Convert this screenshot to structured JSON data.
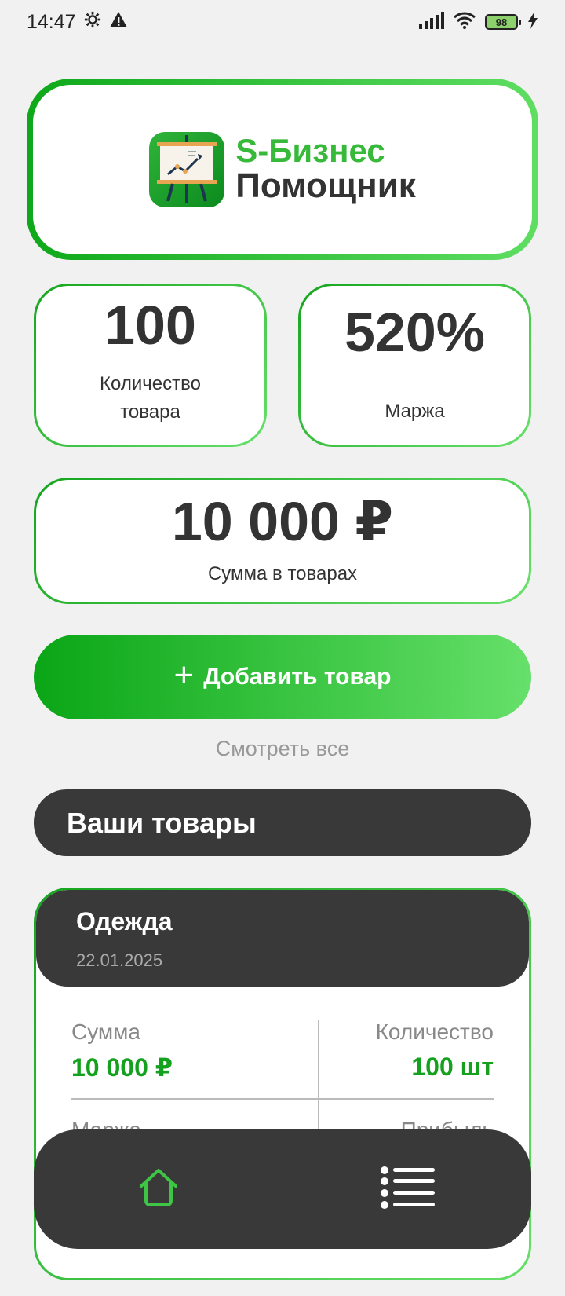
{
  "status_bar": {
    "time": "14:47",
    "battery": "98"
  },
  "logo": {
    "line1": "S-Бизнес",
    "line2": "Помощник"
  },
  "stats": {
    "quantity": {
      "value": "100",
      "label": "Количество товара"
    },
    "margin": {
      "value": "520%",
      "label": "Маржа"
    },
    "sum": {
      "value": "10 000 ₽",
      "label": "Сумма в товарах"
    }
  },
  "actions": {
    "add_product": "Добавить товар",
    "view_all": "Смотреть все"
  },
  "section": {
    "title": "Ваши товары"
  },
  "product": {
    "name": "Одежда",
    "date": "22.01.2025",
    "sum_label": "Сумма",
    "sum_value": "10 000 ₽",
    "qty_label": "Количество",
    "qty_value": "100 шт",
    "margin_label": "Маржа",
    "profit_label": "Прибыль"
  },
  "colors": {
    "accent": "#14a11e",
    "dark": "#393939",
    "background": "#f1f1f1"
  },
  "nav": {
    "items": [
      "home-icon",
      "list-icon"
    ],
    "active": "home-icon"
  }
}
